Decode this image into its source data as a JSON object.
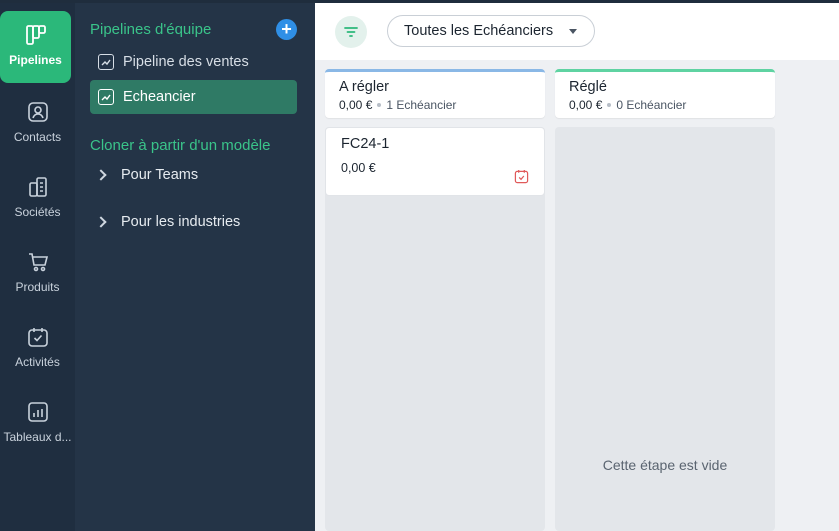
{
  "rail": {
    "items": [
      {
        "label": "Pipelines",
        "icon": "pipelines-icon"
      },
      {
        "label": "Contacts",
        "icon": "contact-icon"
      },
      {
        "label": "Sociétés",
        "icon": "building-icon"
      },
      {
        "label": "Produits",
        "icon": "cart-icon"
      },
      {
        "label": "Activités",
        "icon": "calendar-check-icon"
      },
      {
        "label": "Tableaux d...",
        "icon": "chart-icon"
      }
    ]
  },
  "sidebar": {
    "team_title": "Pipelines d'équipe",
    "add_icon": "plus-icon",
    "pipelines": [
      {
        "label": "Pipeline des ventes"
      },
      {
        "label": "Echeancier"
      }
    ],
    "clone_title": "Cloner à partir d'un modèle",
    "templates": [
      {
        "label": "Pour Teams"
      },
      {
        "label": "Pour les industries"
      }
    ]
  },
  "toolbar": {
    "filter_icon": "filter-icon",
    "select_value": "Toutes les Echéanciers"
  },
  "columns": [
    {
      "title": "A régler",
      "amount": "0,00 €",
      "count": "1 Echéancier",
      "accent": "#8ab8e6",
      "cards": [
        {
          "title": "FC24-1",
          "amount": "0,00 €",
          "icon": "calendar-check-icon"
        }
      ]
    },
    {
      "title": "Réglé",
      "amount": "0,00 €",
      "count": "0 Echéancier",
      "accent": "#5fd3a2",
      "empty_text": "Cette étape est vide"
    }
  ],
  "colors": {
    "brand": "#2bb87a",
    "accent_blue": "#2f8fe6"
  }
}
